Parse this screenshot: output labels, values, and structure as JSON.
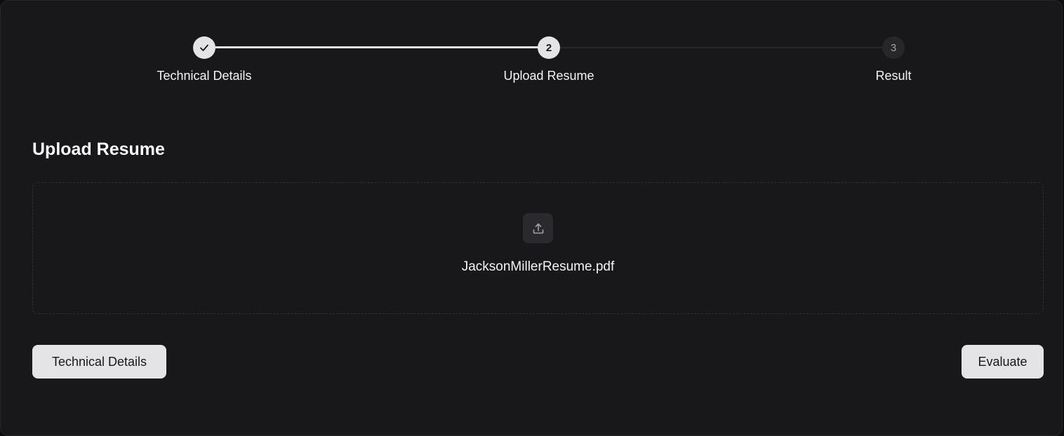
{
  "stepper": {
    "steps": [
      {
        "label": "Technical Details",
        "number": "1",
        "status": "complete",
        "icon": "check-icon"
      },
      {
        "label": "Upload Resume",
        "number": "2",
        "status": "active"
      },
      {
        "label": "Result",
        "number": "3",
        "status": "pending"
      }
    ]
  },
  "upload": {
    "title": "Upload Resume",
    "icon": "upload-icon",
    "file_name": "JacksonMillerResume.pdf"
  },
  "actions": {
    "back_label": "Technical Details",
    "evaluate_label": "Evaluate"
  },
  "colors": {
    "background": "#18181b",
    "accent": "#e4e4e7",
    "muted": "#27272a"
  }
}
